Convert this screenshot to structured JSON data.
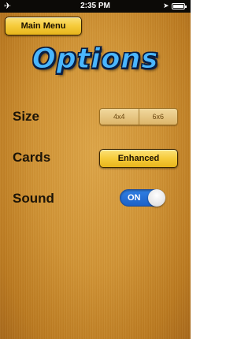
{
  "status_bar": {
    "time": "2:35 PM",
    "airplane_icon": "airplane-icon",
    "location_icon": "location-arrow-icon",
    "battery_icon": "battery-icon"
  },
  "nav": {
    "main_menu_label": "Main Menu"
  },
  "title": "Options",
  "settings": {
    "size": {
      "label": "Size",
      "options": [
        "4x4",
        "6x6"
      ]
    },
    "cards": {
      "label": "Cards",
      "value": "Enhanced"
    },
    "sound": {
      "label": "Sound",
      "state": "ON"
    }
  },
  "colors": {
    "background": "#cf9234",
    "button_yellow": "#f6cb3a",
    "title_blue": "#4ab6ff",
    "toggle_blue": "#2f7fe3"
  }
}
